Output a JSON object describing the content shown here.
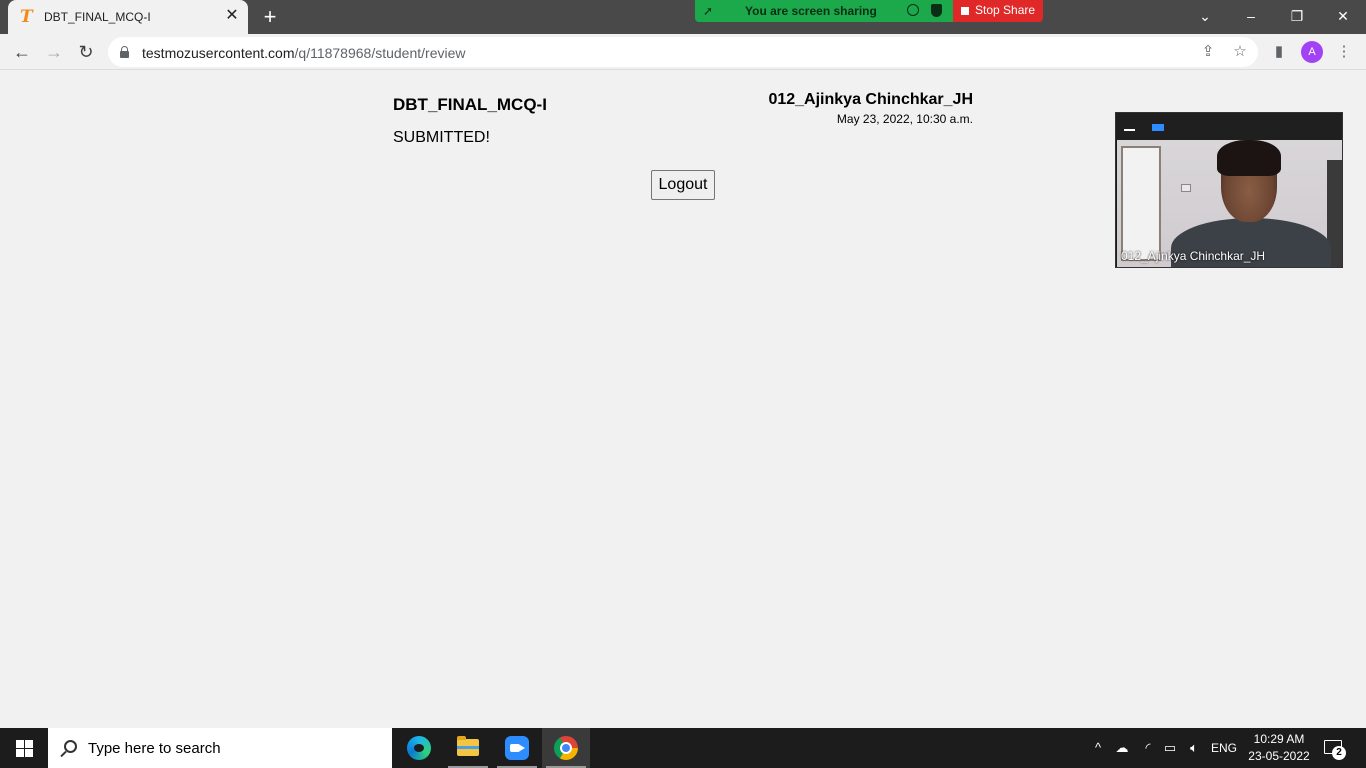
{
  "browser": {
    "tab_title": "DBT_FINAL_MCQ-I",
    "tab_favicon_letter": "T",
    "tab_close": "✕",
    "new_tab": "+",
    "url_host": "testmozusercontent.com",
    "url_path": "/q/11878968/student/review",
    "avatar_letter": "A"
  },
  "screen_share": {
    "status_text": "You are screen sharing",
    "stop_label": "Stop Share"
  },
  "page": {
    "quiz_title": "DBT_FINAL_MCQ-I",
    "status": "SUBMITTED!",
    "student_name": "012_Ajinkya Chinchkar_JH",
    "submitted_date": "May 23, 2022, 10:30 a.m.",
    "logout_label": "Logout"
  },
  "video_panel": {
    "participant_name": "012_Ajinkya Chinchkar_JH"
  },
  "taskbar": {
    "search_placeholder": "Type here to search",
    "language": "ENG",
    "time": "10:29 AM",
    "date": "23-05-2022",
    "notification_count": "2"
  }
}
